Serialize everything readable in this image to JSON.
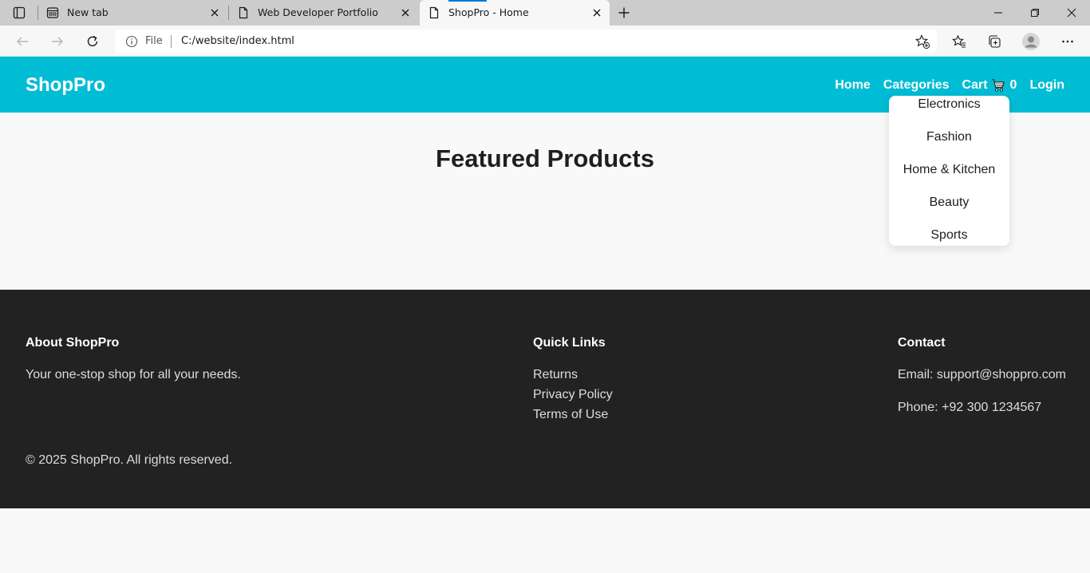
{
  "browser": {
    "tabs": [
      {
        "title": "New tab",
        "icon": "newtab-page-icon"
      },
      {
        "title": "Web Developer Portfolio",
        "icon": "document-icon"
      },
      {
        "title": "ShopPro - Home",
        "icon": "document-icon",
        "active": true
      }
    ],
    "address": {
      "scheme_label": "File",
      "url": "C:/website/index.html"
    },
    "colors": {
      "tabbar": "#cccccc",
      "toolbar": "#f7f7f7",
      "accent": "#0078d4"
    }
  },
  "site": {
    "logo": "ShopPro",
    "nav": {
      "home": "Home",
      "categories": "Categories",
      "cart": "Cart",
      "cart_icon": "cart-icon",
      "cart_count": "0",
      "login": "Login"
    },
    "categories_menu": [
      "Electronics",
      "Fashion",
      "Home & Kitchen",
      "Beauty",
      "Sports"
    ],
    "featured_title": "Featured Products",
    "colors": {
      "header": "#00bcd4",
      "footer": "#222222"
    }
  },
  "footer": {
    "about": {
      "title": "About ShopPro",
      "text": "Your one-stop shop for all your needs."
    },
    "quick_links": {
      "title": "Quick Links",
      "links": [
        "Returns",
        "Privacy Policy",
        "Terms of Use"
      ]
    },
    "contact": {
      "title": "Contact",
      "email": "Email: support@shoppro.com",
      "phone": "Phone: +92 300 1234567"
    },
    "copyright": "© 2025 ShopPro. All rights reserved."
  }
}
